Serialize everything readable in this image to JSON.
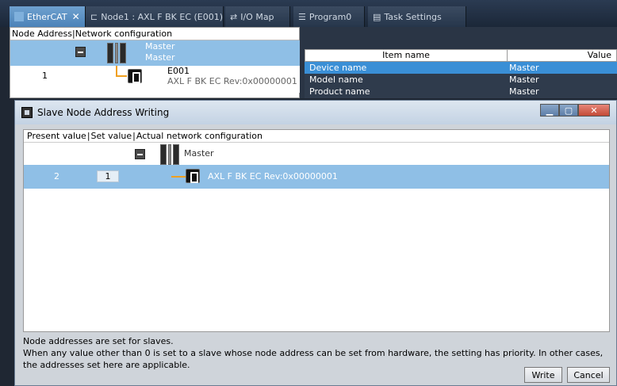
{
  "tabs": [
    {
      "label": "EtherCAT",
      "icon": "ethercat-icon",
      "active": true,
      "closable": true
    },
    {
      "label": "Node1 : AXL F BK EC (E001)",
      "icon": "node-icon"
    },
    {
      "label": "I/O Map",
      "icon": "io-map-icon"
    },
    {
      "label": "Program0",
      "icon": "program-icon"
    },
    {
      "label": "Task Settings",
      "icon": "task-settings-icon"
    }
  ],
  "network": {
    "header": "Node Address|Network configuration",
    "master_label_1": "Master",
    "master_label_2": "Master",
    "node_address": "1",
    "node_name": "E001",
    "node_device": "AXL F BK EC Rev:0x00000001"
  },
  "properties": {
    "col_item": "Item name",
    "col_value": "Value",
    "rows": [
      {
        "item": "Device name",
        "value": "Master"
      },
      {
        "item": "Model name",
        "value": "Master"
      },
      {
        "item": "Product name",
        "value": "Master"
      }
    ]
  },
  "dialog": {
    "title": "Slave Node Address Writing",
    "col_present": "Present value",
    "col_set": "Set value",
    "col_actual": "Actual network configuration",
    "master_label": "Master",
    "slave": {
      "present_value": "2",
      "set_value": "1",
      "device": "AXL F BK EC Rev:0x00000001"
    },
    "info_line1": "Node addresses are set for slaves.",
    "info_line2": "When any value other than 0 is set to a slave whose node address can be set from hardware, the setting has priority. In other cases, the addresses set here are applicable.",
    "write_label": "Write",
    "cancel_label": "Cancel"
  },
  "colors": {
    "selection": "#8fbfe6",
    "tree_line": "#f0a020",
    "active_tab": "#4b82b8"
  }
}
